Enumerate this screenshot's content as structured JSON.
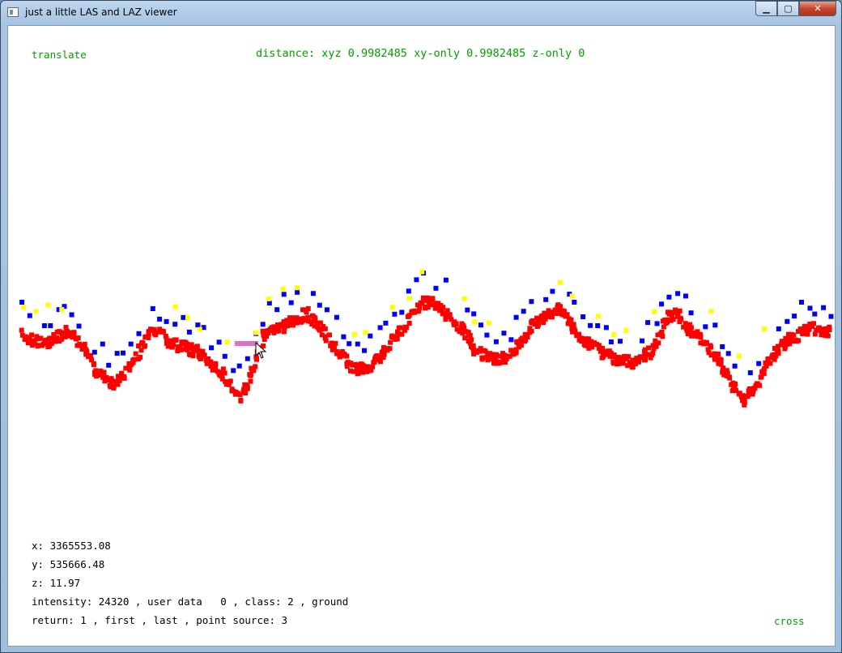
{
  "window": {
    "title": "just a little LAS and LAZ viewer",
    "buttons": {
      "minimize": "▁",
      "maximize": "▢",
      "close": "✕"
    }
  },
  "viewer": {
    "mode": "translate",
    "distance": "distance: xyz 0.9982485 xy-only 0.9982485 z-only 0",
    "x": "x: 3365553.08",
    "y": "y: 535666.48",
    "z": "z: 11.97",
    "intensity": "intensity: 24320 , user data   0 , class: 2 , ground",
    "return": "return: 1 , first , last , point source: 3",
    "cursor_mode": "cross"
  },
  "colors": {
    "red_points": "#ff0000",
    "blue_points": "#0000ff",
    "yellow_points": "#ffff00",
    "measure_line": "#e070c0",
    "status_green": "#00a000"
  }
}
